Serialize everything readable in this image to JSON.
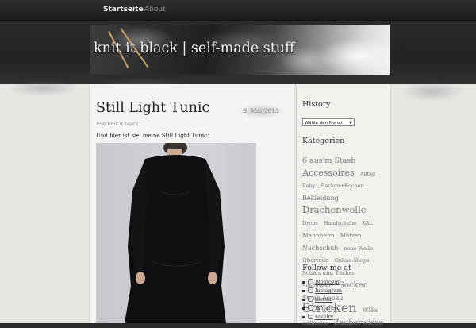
{
  "nav": {
    "items": [
      {
        "label": "Startseite",
        "active": true
      },
      {
        "label": "About",
        "active": false
      }
    ]
  },
  "header": {
    "title": "knit it black | self-made stuff"
  },
  "post": {
    "title": "Still Light Tunic",
    "date": "9. Mai 2013",
    "author": "Von knit it black",
    "intro": "Und hier ist sie, meine Still Light Tunic:"
  },
  "sidebar": {
    "history_title": "History",
    "archive_select": "Wähle den Monat",
    "categories_title": "Kategorien",
    "tags": [
      {
        "label": "6 aus'm Stash",
        "size": 9.5
      },
      {
        "label": "Accessoires",
        "size": 11
      },
      {
        "label": "Alltag",
        "size": 6.5
      },
      {
        "label": "Baby",
        "size": 6.5
      },
      {
        "label": "Backen+Kochen",
        "size": 6.5
      },
      {
        "label": "Bekleidung",
        "size": 8
      },
      {
        "label": "Drachenwolle",
        "size": 11.5
      },
      {
        "label": "Drops",
        "size": 6.5
      },
      {
        "label": "Handschuhe",
        "size": 6.5
      },
      {
        "label": "KAL",
        "size": 6.5
      },
      {
        "label": "Mannheim",
        "size": 7.5
      },
      {
        "label": "Mützen",
        "size": 7
      },
      {
        "label": "Nachschub",
        "size": 8
      },
      {
        "label": "neue Wolle",
        "size": 6.5
      },
      {
        "label": "Oberteile",
        "size": 7
      },
      {
        "label": "Online-Shops",
        "size": 6.5
      },
      {
        "label": "Schals und Tücher",
        "size": 7
      },
      {
        "label": "Sehenswert",
        "size": 6.5
      },
      {
        "label": "Socken",
        "size": 10
      },
      {
        "label": "Stash-Abbau",
        "size": 8
      },
      {
        "label": "Stricken",
        "size": 16
      },
      {
        "label": "WIPs",
        "size": 7.5
      },
      {
        "label": "wollmeise",
        "size": 6.5
      },
      {
        "label": "Zauberwiese",
        "size": 9.5
      }
    ],
    "follow_title": "Follow me at",
    "follow_links": [
      {
        "label": "Bloglovin",
        "icon": "bloglovin-icon"
      },
      {
        "label": "Instagram",
        "icon": "instagram-icon"
      },
      {
        "label": "last.fm",
        "icon": "lastfm-icon"
      },
      {
        "label": "Pinterest",
        "icon": "pinterest-icon"
      },
      {
        "label": "ravelry",
        "icon": "ravelry-icon"
      }
    ]
  }
}
